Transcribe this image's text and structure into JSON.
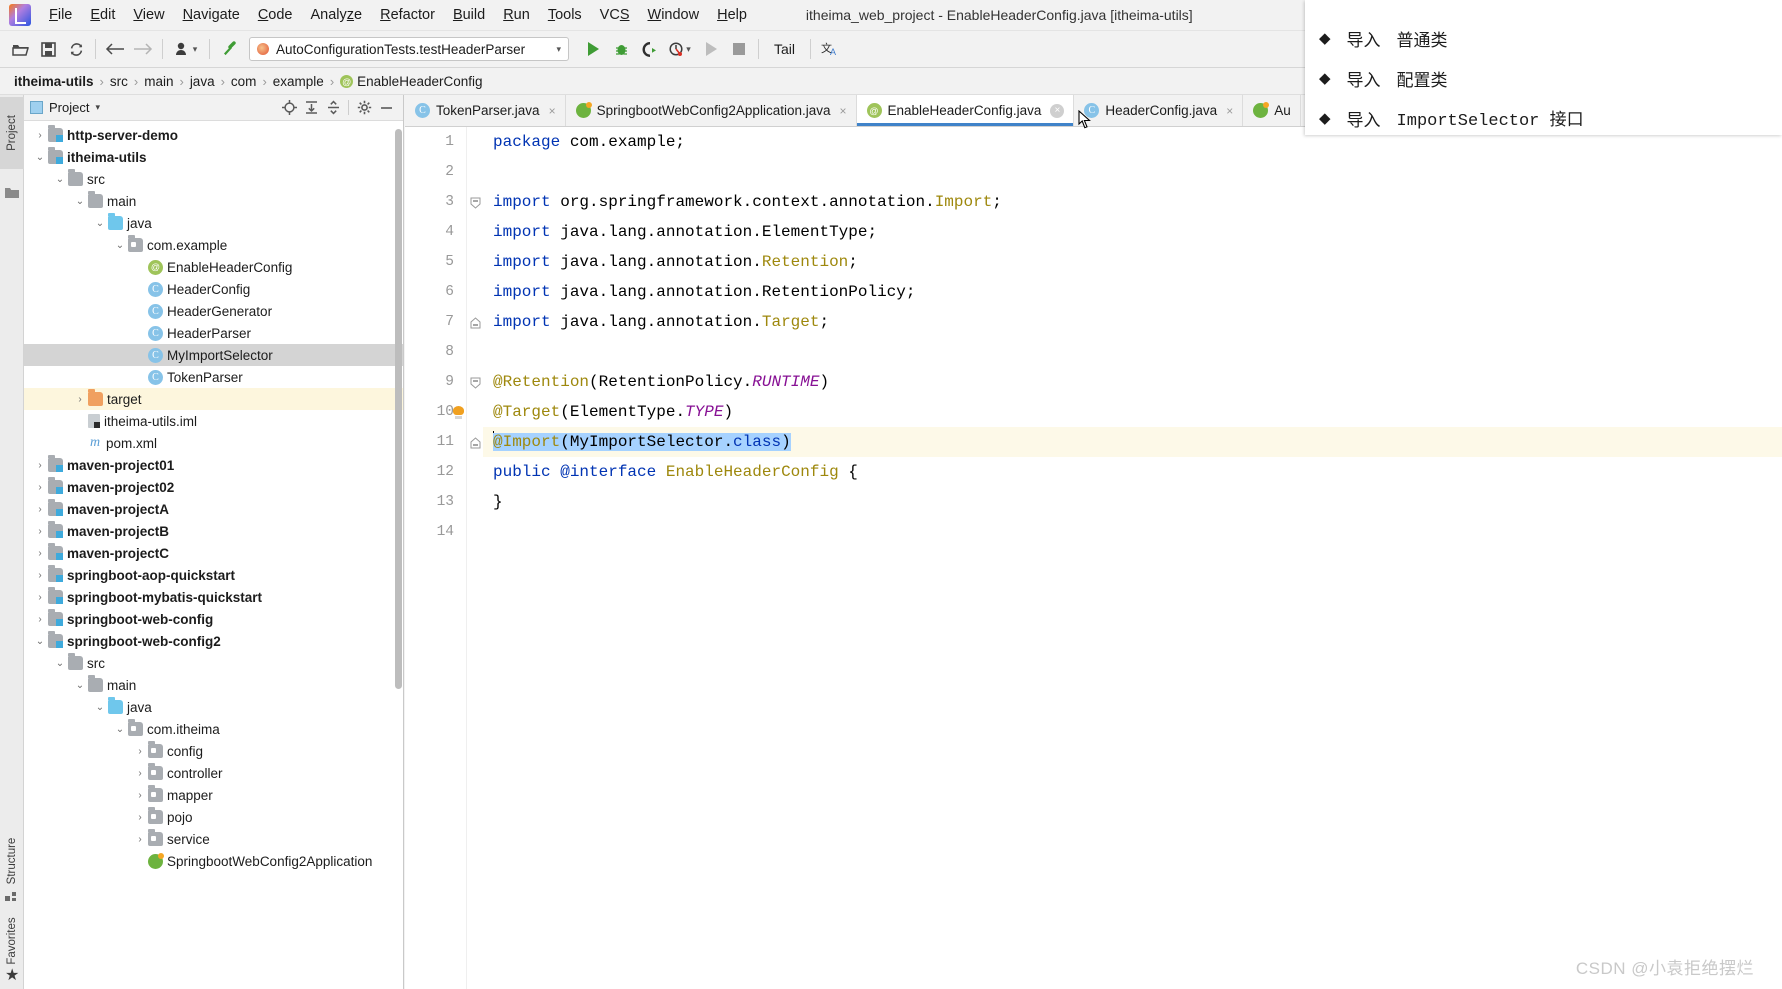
{
  "window": {
    "title": "itheima_web_project - EnableHeaderConfig.java [itheima-utils]",
    "logo_icon": "intellij-idea-logo"
  },
  "menubar": {
    "items": [
      {
        "label": "File",
        "mnemonic": "F"
      },
      {
        "label": "Edit",
        "mnemonic": "E"
      },
      {
        "label": "View",
        "mnemonic": "V"
      },
      {
        "label": "Navigate",
        "mnemonic": "N"
      },
      {
        "label": "Code",
        "mnemonic": "C"
      },
      {
        "label": "Analyze",
        "mnemonic": "z"
      },
      {
        "label": "Refactor",
        "mnemonic": "R"
      },
      {
        "label": "Build",
        "mnemonic": "B"
      },
      {
        "label": "Run",
        "mnemonic": "R"
      },
      {
        "label": "Tools",
        "mnemonic": "T"
      },
      {
        "label": "VCS",
        "mnemonic": "S"
      },
      {
        "label": "Window",
        "mnemonic": "W"
      },
      {
        "label": "Help",
        "mnemonic": "H"
      }
    ]
  },
  "toolbar": {
    "open_icon": "open-folder-icon",
    "save_icon": "save-icon",
    "sync_icon": "refresh-icon",
    "back_icon": "arrow-left-icon",
    "forward_icon": "arrow-right-icon",
    "profile_icon": "user-dropdown-icon",
    "hammer_icon": "build-hammer-icon",
    "run_config": "AutoConfigurationTests.testHeaderParser",
    "run_icon": "run-play-icon",
    "debug_icon": "debug-bug-icon",
    "coverage_icon": "run-with-coverage-icon",
    "profiler_icon": "profiler-icon",
    "rerun_icon": "rerun-dim-icon",
    "stop_icon": "stop-square-icon",
    "tail_label": "Tail",
    "translate_icon": "translate-icon"
  },
  "breadcrumb": {
    "items": [
      "itheima-utils",
      "src",
      "main",
      "java",
      "com",
      "example",
      "EnableHeaderConfig"
    ],
    "separator": "›",
    "last_icon": "annotation-at-icon"
  },
  "rail": {
    "project_label": "Project",
    "structure_label": "Structure",
    "favorites_label": "Favorites",
    "favorites_icon": "star-icon",
    "structure_icon": "structure-icon"
  },
  "project_panel": {
    "title": "Project",
    "title_icon": "project-view-icon",
    "caret_icon": "chevron-down-icon",
    "locate_icon": "scroll-from-source-icon",
    "expand_icon": "expand-all-icon",
    "collapse_icon": "collapse-all-icon",
    "settings_icon": "gear-icon",
    "hide_icon": "minimize-icon",
    "tree": [
      {
        "label": "http-server-demo",
        "indent": 0,
        "twisty": "›",
        "icon": "module-folder",
        "bold": true,
        "state": "normal"
      },
      {
        "label": "itheima-utils",
        "indent": 0,
        "twisty": "⌄",
        "icon": "module-folder",
        "bold": true,
        "state": "normal"
      },
      {
        "label": "src",
        "indent": 1,
        "twisty": "⌄",
        "icon": "folder",
        "bold": false,
        "state": "normal"
      },
      {
        "label": "main",
        "indent": 2,
        "twisty": "⌄",
        "icon": "folder",
        "bold": false,
        "state": "normal"
      },
      {
        "label": "java",
        "indent": 3,
        "twisty": "⌄",
        "icon": "source-folder",
        "bold": false,
        "state": "normal"
      },
      {
        "label": "com.example",
        "indent": 4,
        "twisty": "⌄",
        "icon": "package",
        "bold": false,
        "state": "normal"
      },
      {
        "label": "EnableHeaderConfig",
        "indent": 5,
        "twisty": "",
        "icon": "annotation",
        "bold": false,
        "state": "normal"
      },
      {
        "label": "HeaderConfig",
        "indent": 5,
        "twisty": "",
        "icon": "class",
        "bold": false,
        "state": "normal"
      },
      {
        "label": "HeaderGenerator",
        "indent": 5,
        "twisty": "",
        "icon": "class",
        "bold": false,
        "state": "normal"
      },
      {
        "label": "HeaderParser",
        "indent": 5,
        "twisty": "",
        "icon": "class",
        "bold": false,
        "state": "normal"
      },
      {
        "label": "MyImportSelector",
        "indent": 5,
        "twisty": "",
        "icon": "class",
        "bold": false,
        "state": "selected"
      },
      {
        "label": "TokenParser",
        "indent": 5,
        "twisty": "",
        "icon": "class",
        "bold": false,
        "state": "normal"
      },
      {
        "label": "target",
        "indent": 2,
        "twisty": "›",
        "icon": "target-folder",
        "bold": false,
        "state": "warn"
      },
      {
        "label": "itheima-utils.iml",
        "indent": 2,
        "twisty": "",
        "icon": "iml",
        "bold": false,
        "state": "normal"
      },
      {
        "label": "pom.xml",
        "indent": 2,
        "twisty": "",
        "icon": "pom",
        "bold": false,
        "state": "normal"
      },
      {
        "label": "maven-project01",
        "indent": 0,
        "twisty": "›",
        "icon": "module-folder",
        "bold": true,
        "state": "normal"
      },
      {
        "label": "maven-project02",
        "indent": 0,
        "twisty": "›",
        "icon": "module-folder",
        "bold": true,
        "state": "normal"
      },
      {
        "label": "maven-projectA",
        "indent": 0,
        "twisty": "›",
        "icon": "module-folder",
        "bold": true,
        "state": "normal"
      },
      {
        "label": "maven-projectB",
        "indent": 0,
        "twisty": "›",
        "icon": "module-folder",
        "bold": true,
        "state": "normal"
      },
      {
        "label": "maven-projectC",
        "indent": 0,
        "twisty": "›",
        "icon": "module-folder",
        "bold": true,
        "state": "normal"
      },
      {
        "label": "springboot-aop-quickstart",
        "indent": 0,
        "twisty": "›",
        "icon": "module-folder",
        "bold": true,
        "state": "normal"
      },
      {
        "label": "springboot-mybatis-quickstart",
        "indent": 0,
        "twisty": "›",
        "icon": "module-folder",
        "bold": true,
        "state": "normal"
      },
      {
        "label": "springboot-web-config",
        "indent": 0,
        "twisty": "›",
        "icon": "module-folder",
        "bold": true,
        "state": "normal"
      },
      {
        "label": "springboot-web-config2",
        "indent": 0,
        "twisty": "⌄",
        "icon": "module-folder",
        "bold": true,
        "state": "normal"
      },
      {
        "label": "src",
        "indent": 1,
        "twisty": "⌄",
        "icon": "folder",
        "bold": false,
        "state": "normal"
      },
      {
        "label": "main",
        "indent": 2,
        "twisty": "⌄",
        "icon": "folder",
        "bold": false,
        "state": "normal"
      },
      {
        "label": "java",
        "indent": 3,
        "twisty": "⌄",
        "icon": "source-folder",
        "bold": false,
        "state": "normal"
      },
      {
        "label": "com.itheima",
        "indent": 4,
        "twisty": "⌄",
        "icon": "package",
        "bold": false,
        "state": "normal"
      },
      {
        "label": "config",
        "indent": 5,
        "twisty": "›",
        "icon": "package",
        "bold": false,
        "state": "normal"
      },
      {
        "label": "controller",
        "indent": 5,
        "twisty": "›",
        "icon": "package",
        "bold": false,
        "state": "normal"
      },
      {
        "label": "mapper",
        "indent": 5,
        "twisty": "›",
        "icon": "package",
        "bold": false,
        "state": "normal"
      },
      {
        "label": "pojo",
        "indent": 5,
        "twisty": "›",
        "icon": "package",
        "bold": false,
        "state": "normal"
      },
      {
        "label": "service",
        "indent": 5,
        "twisty": "›",
        "icon": "package",
        "bold": false,
        "state": "normal"
      },
      {
        "label": "SpringbootWebConfig2Application",
        "indent": 5,
        "twisty": "",
        "icon": "spring",
        "bold": false,
        "state": "normal"
      }
    ]
  },
  "editor_tabs": [
    {
      "label": "TokenParser.java",
      "icon": "class",
      "active": false,
      "close": "x"
    },
    {
      "label": "SpringbootWebConfig2Application.java",
      "icon": "spring",
      "active": false,
      "close": "x"
    },
    {
      "label": "EnableHeaderConfig.java",
      "icon": "annotation",
      "active": true,
      "close": "circle-x"
    },
    {
      "label": "HeaderConfig.java",
      "icon": "class",
      "active": false,
      "close": "x"
    },
    {
      "label": "Au",
      "icon": "spring",
      "active": false,
      "close": ""
    }
  ],
  "editor": {
    "filename": "EnableHeaderConfig.java",
    "line_numbers": [
      "1",
      "2",
      "3",
      "4",
      "5",
      "6",
      "7",
      "8",
      "9",
      "10",
      "11",
      "12",
      "13",
      "14"
    ],
    "lines": [
      {
        "n": "1",
        "tokens": [
          {
            "t": "package ",
            "c": "kw"
          },
          {
            "t": "com.example;",
            "c": "plain"
          }
        ]
      },
      {
        "n": "2",
        "tokens": []
      },
      {
        "n": "3",
        "fold": "minus-top",
        "tokens": [
          {
            "t": "import ",
            "c": "kw"
          },
          {
            "t": "org.springframework.context.annotation.",
            "c": "plain"
          },
          {
            "t": "Import",
            "c": "cls"
          },
          {
            "t": ";",
            "c": "plain"
          }
        ]
      },
      {
        "n": "4",
        "tokens": [
          {
            "t": "import ",
            "c": "kw"
          },
          {
            "t": "java.lang.annotation.ElementType;",
            "c": "plain"
          }
        ]
      },
      {
        "n": "5",
        "tokens": [
          {
            "t": "import ",
            "c": "kw"
          },
          {
            "t": "java.lang.annotation.",
            "c": "plain"
          },
          {
            "t": "Retention",
            "c": "cls"
          },
          {
            "t": ";",
            "c": "plain"
          }
        ]
      },
      {
        "n": "6",
        "tokens": [
          {
            "t": "import ",
            "c": "kw"
          },
          {
            "t": "java.lang.annotation.RetentionPolicy;",
            "c": "plain"
          }
        ]
      },
      {
        "n": "7",
        "fold": "minus-bottom",
        "tokens": [
          {
            "t": "import ",
            "c": "kw"
          },
          {
            "t": "java.lang.annotation.",
            "c": "plain"
          },
          {
            "t": "Target",
            "c": "cls"
          },
          {
            "t": ";",
            "c": "plain"
          }
        ]
      },
      {
        "n": "8",
        "tokens": []
      },
      {
        "n": "9",
        "fold": "minus-top",
        "tokens": [
          {
            "t": "@Retention",
            "c": "ann"
          },
          {
            "t": "(RetentionPolicy.",
            "c": "plain"
          },
          {
            "t": "RUNTIME",
            "c": "stat"
          },
          {
            "t": ")",
            "c": "plain"
          }
        ]
      },
      {
        "n": "10",
        "bulb": true,
        "tokens": [
          {
            "t": "@Target",
            "c": "ann"
          },
          {
            "t": "(ElementType.",
            "c": "plain"
          },
          {
            "t": "TYPE",
            "c": "stat"
          },
          {
            "t": ")",
            "c": "plain"
          }
        ]
      },
      {
        "n": "11",
        "highlight": true,
        "caret": true,
        "fold": "minus-bottom",
        "tokens": [
          {
            "t": "@Import",
            "c": "ann sel"
          },
          {
            "t": "(MyImportSelector.",
            "c": "plain sel"
          },
          {
            "t": "class",
            "c": "kw sel"
          },
          {
            "t": ")",
            "c": "plain sel"
          }
        ]
      },
      {
        "n": "12",
        "tokens": [
          {
            "t": "public ",
            "c": "kw"
          },
          {
            "t": "@interface ",
            "c": "kw"
          },
          {
            "t": "EnableHeaderConfig",
            "c": "cls"
          },
          {
            "t": " {",
            "c": "plain"
          }
        ]
      },
      {
        "n": "13",
        "tokens": [
          {
            "t": "}",
            "c": "plain"
          }
        ]
      },
      {
        "n": "14",
        "tokens": []
      }
    ]
  },
  "overlay": {
    "bullet": "◆",
    "rows": [
      {
        "prefix": "导入",
        "text": "普通类"
      },
      {
        "prefix": "导入",
        "text": "配置类"
      },
      {
        "prefix": "导入",
        "text": "ImportSelector 接口"
      }
    ]
  },
  "watermark": "CSDN @小袁拒绝摆烂",
  "colors": {
    "accent_blue": "#4083c9",
    "selection_blue": "#a6d2ff",
    "keyword_blue": "#0033b3",
    "annotation_gold": "#9e880d",
    "static_purple": "#871094",
    "chrome_gray": "#f2f2f2",
    "tree_selected": "#d4d4d4",
    "tree_warn": "#fdf6dd",
    "line_highlight": "#fdf9e8"
  }
}
